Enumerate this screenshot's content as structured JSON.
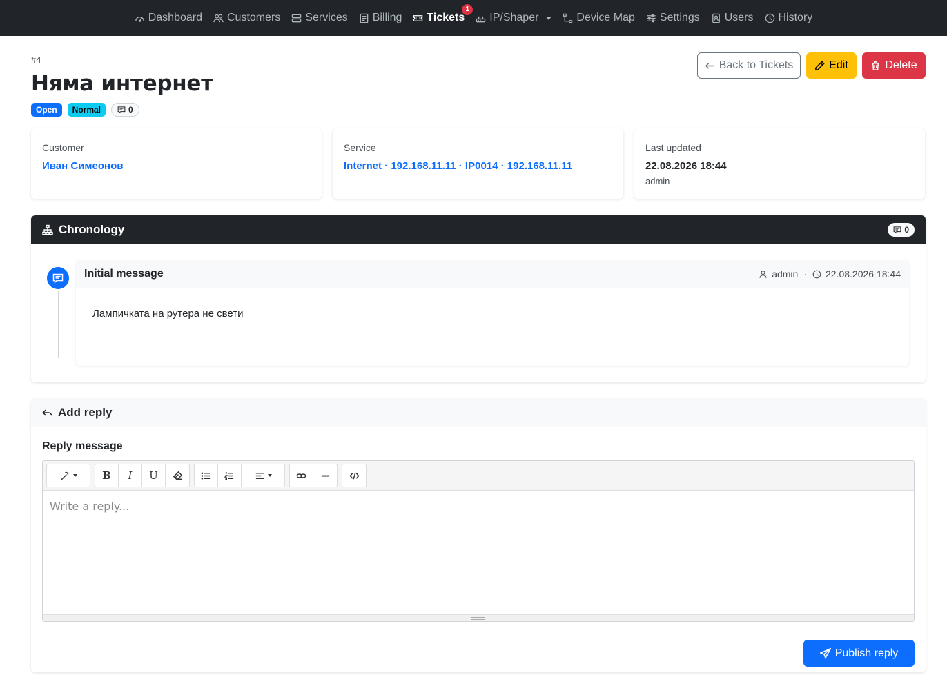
{
  "nav": {
    "items": [
      {
        "label": "Dashboard",
        "icon": "dashboard-icon"
      },
      {
        "label": "Customers",
        "icon": "people-icon"
      },
      {
        "label": "Services",
        "icon": "server-icon"
      },
      {
        "label": "Billing",
        "icon": "billing-icon"
      },
      {
        "label": "Tickets",
        "icon": "ticket-icon",
        "active": true,
        "badge": "1"
      },
      {
        "label": "IP/Shaper",
        "icon": "router-icon",
        "dropdown": true
      },
      {
        "label": "Device Map",
        "icon": "diagram-icon"
      },
      {
        "label": "Settings",
        "icon": "sliders-icon"
      },
      {
        "label": "Users",
        "icon": "user-badge-icon"
      },
      {
        "label": "History",
        "icon": "clock-icon"
      }
    ]
  },
  "ticket": {
    "number": "#4",
    "title": "Няма интернет",
    "status": "Open",
    "priority": "Normal",
    "comment_count": "0"
  },
  "actions": {
    "back": "Back to Tickets",
    "edit": "Edit",
    "delete": "Delete"
  },
  "info": {
    "customer_label": "Customer",
    "customer_value": "Иван Симеонов",
    "service_label": "Service",
    "service_value": "Internet · 192.168.11.11 · IP0014 · 192.168.11.11",
    "updated_label": "Last updated",
    "updated_value": "22.08.2026 18:44",
    "updated_by": "admin"
  },
  "chronology": {
    "title": "Chronology",
    "count": "0",
    "message": {
      "title": "Initial message",
      "author": "admin",
      "separator": "·",
      "timestamp": "22.08.2026 18:44",
      "body": "Лампичката на рутера не свети"
    }
  },
  "reply": {
    "header": "Add reply",
    "label": "Reply message",
    "placeholder": "Write a reply...",
    "submit": "Publish reply"
  },
  "colors": {
    "navbar": "#212529",
    "primary": "#0d6efd",
    "warning": "#ffc107",
    "danger": "#dc3545",
    "info": "#0dcaf0"
  }
}
